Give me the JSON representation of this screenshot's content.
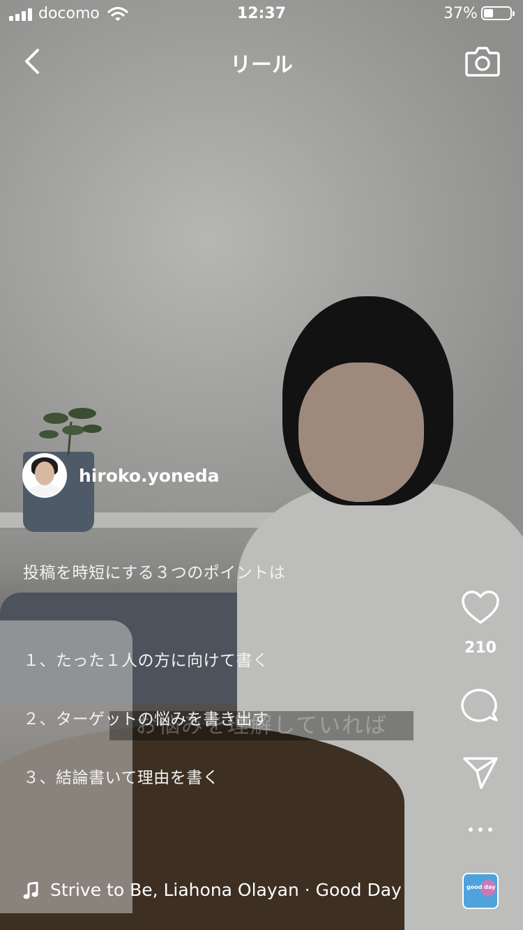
{
  "status_bar": {
    "carrier": "docomo",
    "time": "12:37",
    "battery_pct": "37%"
  },
  "header": {
    "title": "リール",
    "back_icon": "chevron-left-icon",
    "camera_icon": "camera-icon"
  },
  "video": {
    "burned_subtitle": "お悩みを理解していれば"
  },
  "post": {
    "username": "hiroko.yoneda",
    "caption_lines": [
      "投稿を時短にする３つのポイントは",
      "１、たった１人の方に向けて書く",
      "２、ターゲットの悩みを書き出す",
      "３、結論書いて理由を書く"
    ]
  },
  "actions": {
    "like_count": "210",
    "icons": [
      "heart-icon",
      "comment-icon",
      "share-icon",
      "more-icon"
    ]
  },
  "audio": {
    "label": "Strive to Be, Liahona Olayan · Good Day",
    "album_text": "good day"
  },
  "colors": {
    "text": "#ffffff",
    "album_bg": "#4fa3dd"
  }
}
